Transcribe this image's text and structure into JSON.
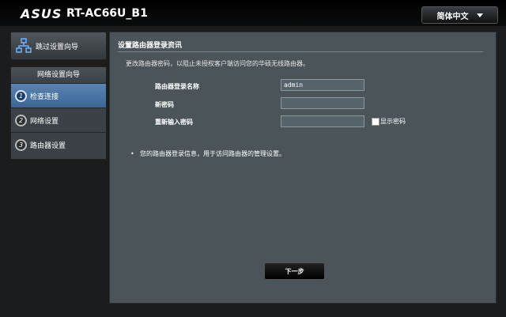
{
  "header": {
    "brand": "ASUS",
    "model": "RT-AC66U_B1",
    "language": "简体中文"
  },
  "sidebar": {
    "skip_label": "跳过设置向导",
    "wizard_title": "网络设置向导",
    "steps": [
      {
        "num": "1",
        "label": "检查连接"
      },
      {
        "num": "2",
        "label": "网络设置"
      },
      {
        "num": "3",
        "label": "路由器设置"
      }
    ]
  },
  "main": {
    "title": "设置路由器登录资讯",
    "description": "更改路由器密码，以阻止未授权客户端访问您的华硕无线路由器。",
    "fields": [
      {
        "label": "路由器登录名称",
        "value": "admin"
      },
      {
        "label": "新密码",
        "value": ""
      },
      {
        "label": "重新输入密码",
        "value": ""
      }
    ],
    "show_password_label": "显示密码",
    "note": "您的路由器登录信息，用于访问路由器的管理设置。",
    "next_label": "下一步"
  }
}
